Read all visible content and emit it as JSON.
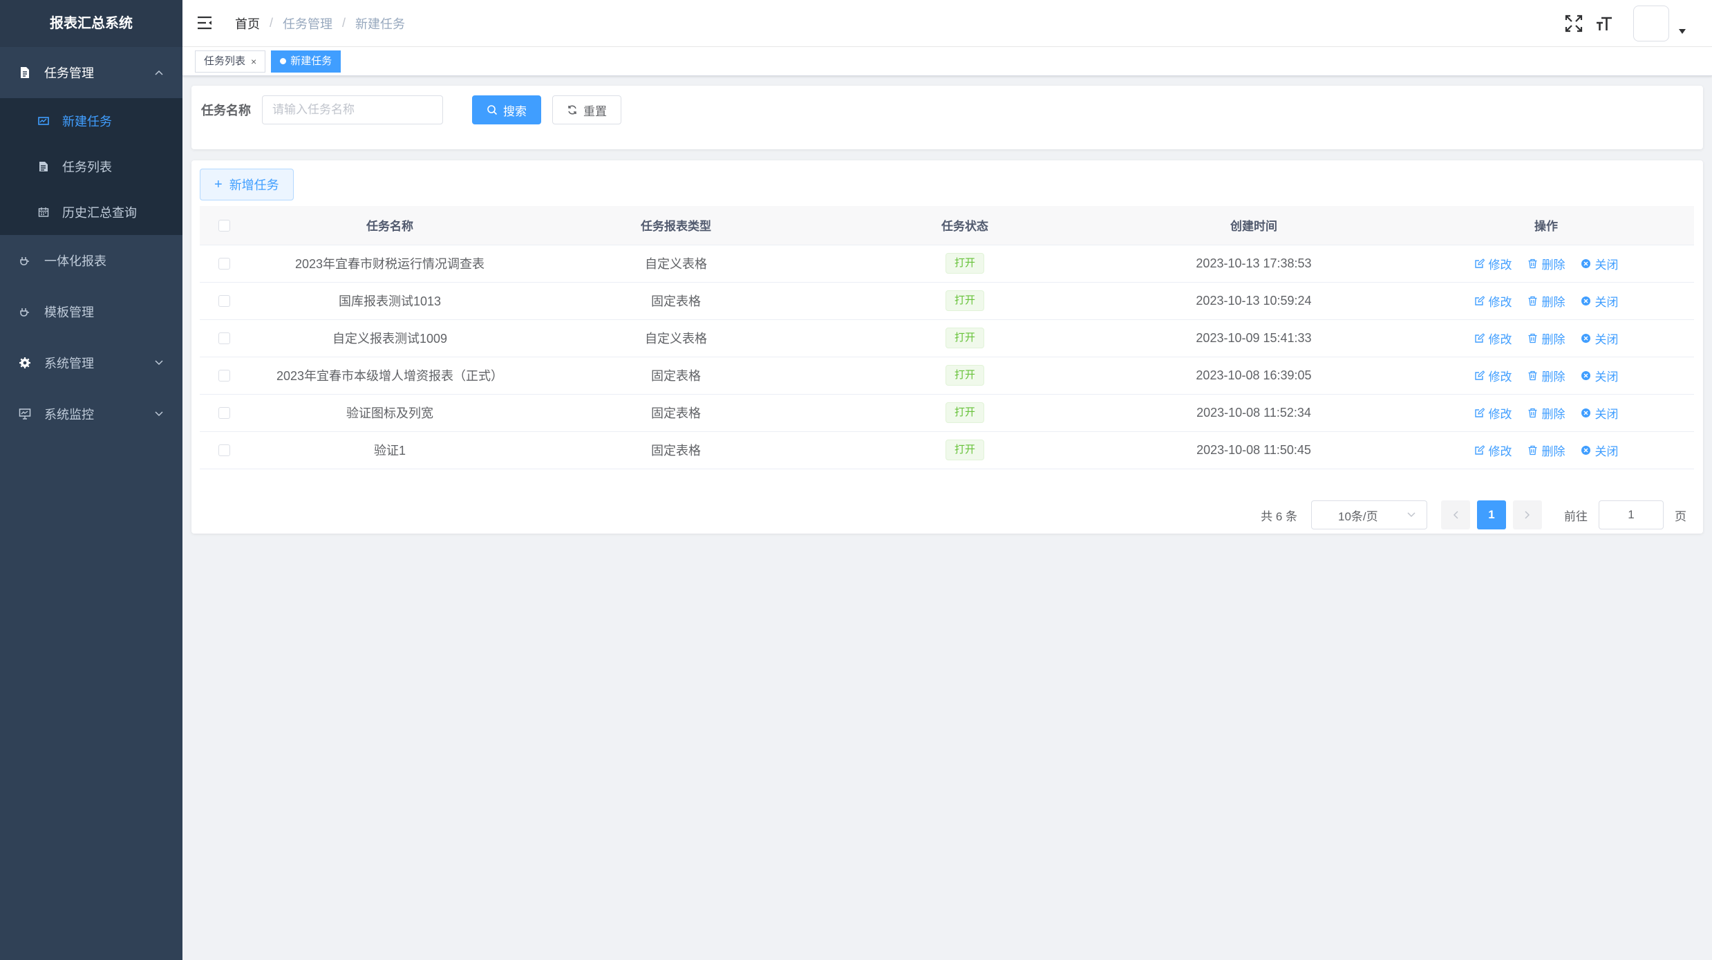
{
  "app": {
    "title": "报表汇总系统"
  },
  "sidebar": {
    "menus": [
      {
        "label": "任务管理",
        "icon": "document-icon",
        "expanded": true,
        "children": [
          {
            "label": "新建任务",
            "icon": "form-icon",
            "active": true
          },
          {
            "label": "任务列表",
            "icon": "list-icon",
            "active": false
          },
          {
            "label": "历史汇总查询",
            "icon": "calendar-icon",
            "active": false
          }
        ]
      },
      {
        "label": "一体化报表",
        "icon": "plug-icon"
      },
      {
        "label": "模板管理",
        "icon": "plug-icon"
      },
      {
        "label": "系统管理",
        "icon": "gear-icon"
      },
      {
        "label": "系统监控",
        "icon": "monitor-icon"
      }
    ]
  },
  "navbar": {
    "breadcrumb": [
      "首页",
      "任务管理",
      "新建任务"
    ],
    "separator": "/"
  },
  "tags": [
    {
      "label": "任务列表",
      "active": false
    },
    {
      "label": "新建任务",
      "active": true
    }
  ],
  "search": {
    "label": "任务名称",
    "placeholder": "请输入任务名称",
    "value": "",
    "search_button": "搜索",
    "reset_button": "重置"
  },
  "toolbar": {
    "add_button": "新增任务"
  },
  "table": {
    "columns": [
      "任务名称",
      "任务报表类型",
      "任务状态",
      "创建时间",
      "操作"
    ],
    "rows": [
      {
        "name": "2023年宜春市财税运行情况调查表",
        "type": "自定义表格",
        "status": "打开",
        "created": "2023-10-13 17:38:53"
      },
      {
        "name": "国库报表测试1013",
        "type": "固定表格",
        "status": "打开",
        "created": "2023-10-13 10:59:24"
      },
      {
        "name": "自定义报表测试1009",
        "type": "自定义表格",
        "status": "打开",
        "created": "2023-10-09 15:41:33"
      },
      {
        "name": "2023年宜春市本级增人增资报表（正式）",
        "type": "固定表格",
        "status": "打开",
        "created": "2023-10-08 16:39:05"
      },
      {
        "name": "验证图标及列宽",
        "type": "固定表格",
        "status": "打开",
        "created": "2023-10-08 11:52:34"
      },
      {
        "name": "验证1",
        "type": "固定表格",
        "status": "打开",
        "created": "2023-10-08 11:50:45"
      }
    ],
    "actions": {
      "edit": "修改",
      "delete": "删除",
      "close": "关闭"
    }
  },
  "pagination": {
    "total_text": "共 6 条",
    "page_size": "10条/页",
    "current_page": "1",
    "goto_label": "前往",
    "goto_value": "1",
    "page_suffix": "页"
  },
  "colors": {
    "sidebar_bg": "#304156",
    "accent": "#409eff",
    "status_green": "#67c23a"
  }
}
